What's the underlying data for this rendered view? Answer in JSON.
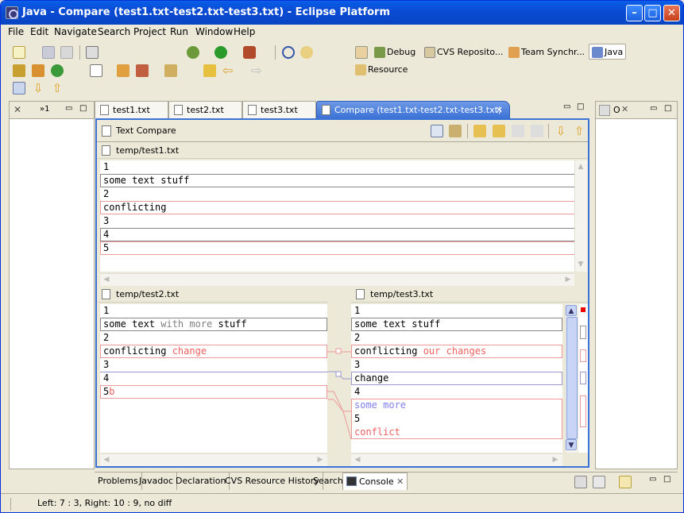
{
  "window": {
    "title": "Java - Compare (test1.txt-test2.txt-test3.txt) - Eclipse Platform"
  },
  "menu": [
    "File",
    "Edit",
    "Navigate",
    "Search",
    "Project",
    "Run",
    "Window",
    "Help"
  ],
  "perspectives": [
    "Debug",
    "CVS Reposito...",
    "Team Synchr...",
    "Java",
    "Resource"
  ],
  "left_view": {
    "tab_label": "»1"
  },
  "right_view": {
    "tab_label": "O"
  },
  "editor_tabs": [
    "test1.txt",
    "test2.txt",
    "test3.txt",
    "Compare (test1.txt-test2.txt-test3.txt)"
  ],
  "compare": {
    "title": "Text Compare",
    "ancestor": {
      "path": "temp/test1.txt",
      "lines": [
        "1",
        "some text stuff",
        "2",
        "conflicting",
        "3",
        "4",
        "5"
      ]
    },
    "left": {
      "path": "temp/test2.txt",
      "lines": [
        {
          "text": "1"
        },
        {
          "parts": [
            "some text ",
            "with more",
            " stuff"
          ]
        },
        {
          "text": "2"
        },
        {
          "parts": [
            "conflicting ",
            "change"
          ]
        },
        {
          "text": "3"
        },
        {
          "text": "4"
        },
        {
          "parts": [
            "5",
            "b"
          ]
        }
      ]
    },
    "right": {
      "path": "temp/test3.txt",
      "lines": [
        {
          "text": "1"
        },
        {
          "text": "some text stuff"
        },
        {
          "text": "2"
        },
        {
          "parts": [
            "conflicting ",
            "our changes"
          ]
        },
        {
          "text": "3"
        },
        {
          "text": "change"
        },
        {
          "text": "4"
        },
        {
          "text": "some more"
        },
        {
          "text": "5"
        },
        {
          "text": "conflict"
        }
      ]
    }
  },
  "bottom_tabs": [
    "Problems",
    "Javadoc",
    "Declaration",
    "CVS Resource History",
    "Search",
    "Console"
  ],
  "status": {
    "text": "Left: 7 : 3, Right: 10 : 9, no diff"
  }
}
